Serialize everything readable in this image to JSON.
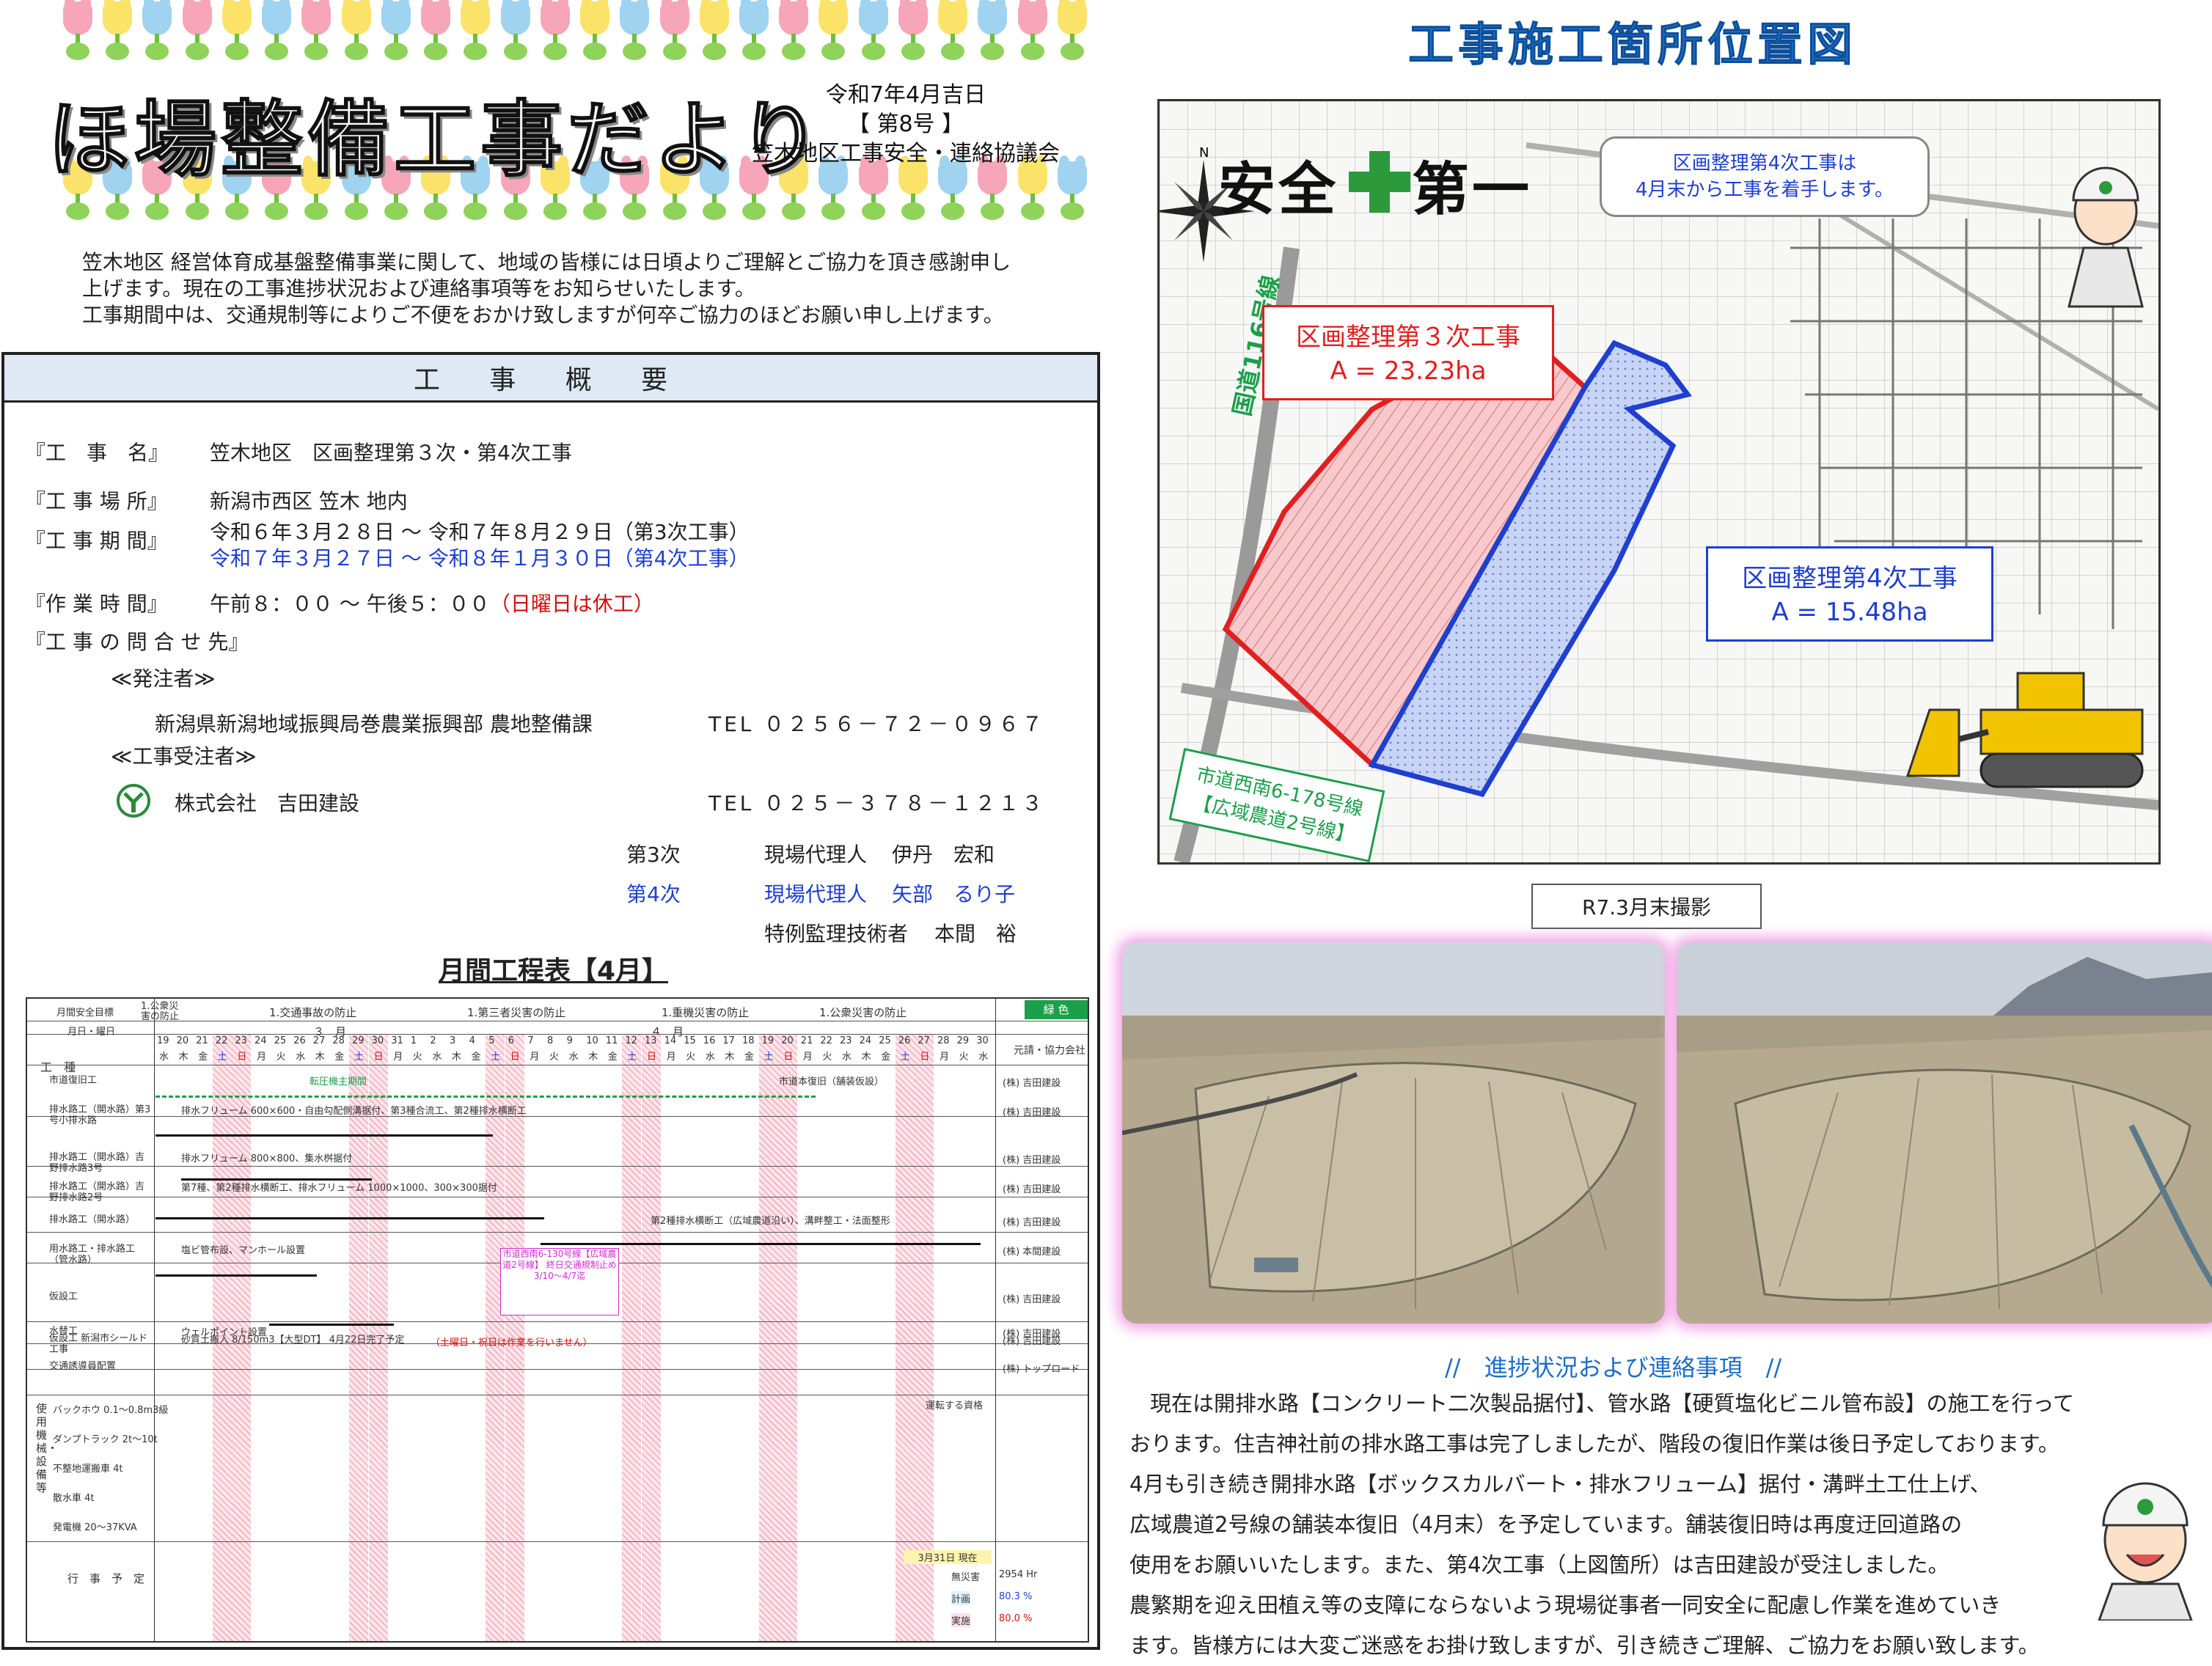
{
  "header": {
    "title": "ほ場整備工事だより",
    "date": "令和7年4月吉日",
    "issue": "【 第8号 】",
    "council": "笠木地区工事安全・連絡協議会",
    "intro": [
      "笠木地区 経営体育成基盤整備事業に関して、地域の皆様には日頃よりご理解とご協力を頂き感謝申し",
      "上げます。現在の工事進捗状況および連絡事項等をお知らせいたします。",
      "工事期間中は、交通規制等によりご不便をおかけ致しますが何卒ご協力のほどお願い申し上げます。"
    ]
  },
  "overview": {
    "heading": "工 事 概 要",
    "name_label": "『工　事　名』",
    "name_value": "笠木地区　区画整理第３次・第4次工事",
    "place_label": "『工 事 場 所』",
    "place_value": "新潟市西区 笠木 地内",
    "period_label": "『工 事 期 間』",
    "period_3": "令和６年３月２８日 ～ 令和７年８月２９日（第3次工事）",
    "period_4": "令和７年３月２７日 ～ 令和８年１月３０日（第4次工事）",
    "hours_label": "『作 業 時 間』",
    "hours_value": "午前８：００ ～ 午後５：００",
    "hours_note": "（日曜日は休工）",
    "contact_label": "『工 事 の 問 合 せ 先』",
    "orderer_label": "≪発注者≫",
    "orderer_name": "新潟県新潟地域振興局巻農業振興部 農地整備課",
    "orderer_tel": "TEL ０２５６－７２－０９６７",
    "contractor_label": "≪工事受注者≫",
    "contractor_name": "株式会社　吉田建設",
    "contractor_tel": "TEL ０２５－３７８－１２１３",
    "staff": [
      {
        "phase": "第3次",
        "role": "現場代理人",
        "name": "伊丹　宏和"
      },
      {
        "phase": "第4次",
        "role": "現場代理人",
        "name": "矢部　るり子"
      },
      {
        "phase": "",
        "role": "特例監理技術者",
        "name": "本間　裕"
      }
    ]
  },
  "schedule": {
    "title": "月間工程表【4月】",
    "goal_label": "月間安全目標",
    "goals": [
      "1.公衆災害の防止",
      "1.交通事故の防止",
      "1.第三者災害の防止",
      "1.重機災害の防止",
      "1.公衆災害の防止"
    ],
    "color_label": "緑 色",
    "month_day_label": "月日・曜日",
    "work_label": "工　種",
    "contractor_col": "元請・協力会社",
    "month_march": "３　月",
    "month_april": "４　月",
    "days": [
      "19",
      "20",
      "21",
      "22",
      "23",
      "24",
      "25",
      "26",
      "27",
      "28",
      "29",
      "30",
      "31",
      "1",
      "2",
      "3",
      "4",
      "5",
      "6",
      "7",
      "8",
      "9",
      "10",
      "11",
      "12",
      "13",
      "14",
      "15",
      "16",
      "17",
      "18",
      "19",
      "20",
      "21",
      "22",
      "23",
      "24",
      "25",
      "26",
      "27",
      "28",
      "29",
      "30"
    ],
    "weekdays": [
      "水",
      "木",
      "金",
      "土",
      "日",
      "月",
      "火",
      "水",
      "木",
      "金",
      "土",
      "日",
      "月",
      "火",
      "水",
      "木",
      "金",
      "土",
      "日",
      "月",
      "火",
      "水",
      "木",
      "金",
      "土",
      "日",
      "月",
      "火",
      "水",
      "木",
      "金",
      "土",
      "日",
      "月",
      "火",
      "水",
      "木",
      "金",
      "土",
      "日",
      "月",
      "火",
      "水"
    ],
    "rows": [
      {
        "work": "市道復旧工",
        "note": "市道本復旧（舗装仮設）",
        "company": "(株) 吉田建設"
      },
      {
        "work": "排水路工（開水路）第3号小排水路",
        "note": "排水フリューム 600×600・自由勾配側溝据付、第3種合流工、第2種排水横断工",
        "company": "(株) 吉田建設"
      },
      {
        "work": "排水路工（開水路）吉野排水路3号",
        "note": "排水フリューム 800×800、集水桝据付",
        "company": "(株) 吉田建設"
      },
      {
        "work": "排水路工（開水路）吉野排水路2号",
        "note": "第7種、第2種排水横断工、排水フリューム 1000×1000、300×300据付",
        "company": "(株) 吉田建設"
      },
      {
        "work": "排水路工（開水路）",
        "note": "第2種排水横断工（広域農道沿い）、溝畔整工・法面整形",
        "company": "(株) 吉田建設"
      },
      {
        "work": "用水路工・排水路工（管水路）",
        "note": "塩ビ管布設、マンホール設置",
        "company": "(株) 本間建設"
      },
      {
        "work": "仮設工",
        "note": "",
        "company": "(株) 吉田建設"
      },
      {
        "work": "水替工",
        "note": "ウェルポイント設置",
        "company": "(株) 吉田建設"
      },
      {
        "work": "仮設工 新潟市シールド工事",
        "note": "砂質土搬入 8/150m3【大型DT】 4月22日完了予定",
        "company": "(株) 吉田建設"
      },
      {
        "work": "交通誘導員配置",
        "note": "",
        "company": "(株) トップロード"
      }
    ],
    "red_note": "（土曜日・祝日は作業を行いません）",
    "notice": "市道西南6-130号線【広域農道2号線】 終日交通規制止め 3/10～4/7迄",
    "early_note": "転圧機主期間",
    "equipment_label": "使用機械・設備等",
    "equipment": [
      "バックホウ 0.1～0.8m3級",
      "ダンプトラック 2t～10t",
      "不整地運搬車 4t",
      "散水車 4t",
      "発電機 20～37KVA"
    ],
    "license_label": "運転する資格",
    "event_label": "行　事　予　定",
    "stats_date": "3月31日 現在",
    "stats": [
      {
        "label": "無災害",
        "value": "2954 Hr"
      },
      {
        "label": "計画",
        "value": "80.3 %"
      },
      {
        "label": "実施",
        "value": "80.0 %"
      }
    ]
  },
  "map": {
    "title": "工事施工箇所位置図",
    "slogan_a": "安全",
    "slogan_b": "第一",
    "road_label": "国道116号線",
    "bubble": [
      "区画整理第4次工事は",
      "4月末から工事を着手します。"
    ],
    "area3_name": "区画整理第３次工事",
    "area3_size": "A = 23.23ha",
    "area4_name": "区画整理第4次工事",
    "area4_size": "A = 15.48ha",
    "road2": [
      "市道西南6-178号線",
      "【広域農道2号線】"
    ],
    "colors": {
      "area3": "#e02020",
      "area4": "#1f3fd0",
      "road": "#1aa04a"
    }
  },
  "photos": {
    "caption": "R7.3月末撮影"
  },
  "progress": {
    "title": "//　進捗状況および連絡事項　//",
    "lines": [
      "現在は開排水路【コンクリート二次製品据付】、管水路【硬質塩化ビニル管布設】の施工を行って",
      "おります。住吉神社前の排水路工事は完了しましたが、階段の復旧作業は後日予定しております。",
      "4月も引き続き開排水路【ボックスカルバート・排水フリューム】据付・溝畔土工仕上げ、",
      "広域農道2号線の舗装本復旧（4月末）を予定しています。舗装復旧時は再度迂回道路の",
      "使用をお願いいたします。また、第4次工事（上図箇所）は吉田建設が受注しました。",
      "農繁期を迎え田植え等の支障にならないよう現場従事者一同安全に配慮し作業を進めていき",
      "ます。皆様方には大変ご迷惑をお掛け致しますが、引き続きご理解、ご協力をお願い致します。"
    ]
  }
}
